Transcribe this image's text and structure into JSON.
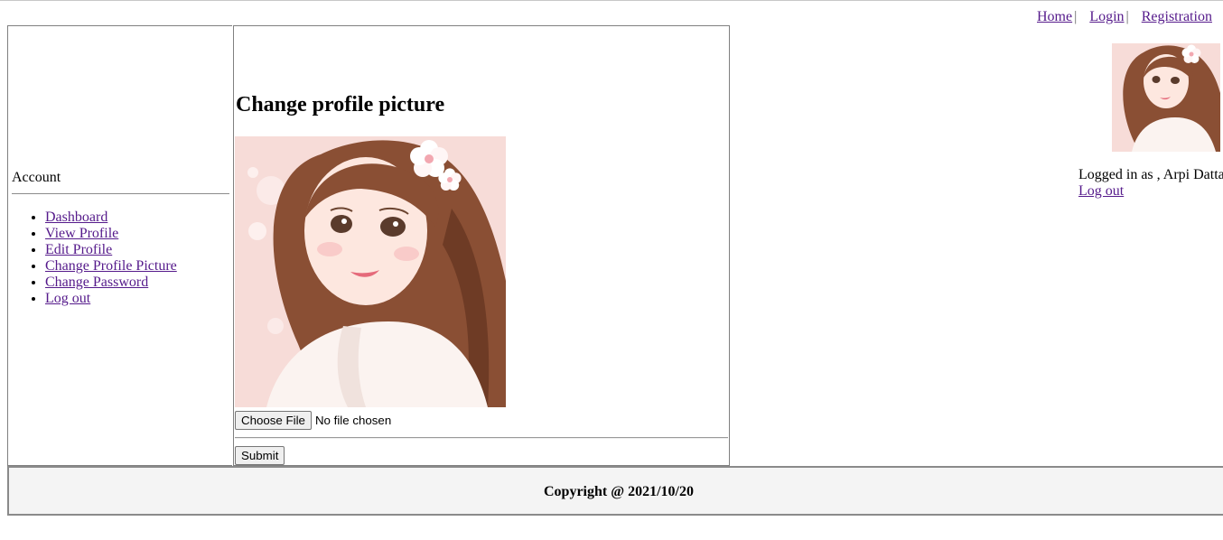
{
  "nav": {
    "links": [
      "Home",
      "Login",
      "Registration"
    ],
    "separator": "|"
  },
  "sidebar": {
    "title": "Account",
    "items": [
      "Dashboard",
      "View Profile",
      "Edit Profile",
      "Change Profile Picture",
      "Change Password",
      "Log out"
    ]
  },
  "main": {
    "title": "Change profile picture",
    "choose_file_label": "Choose File",
    "file_status": "No file chosen",
    "submit_label": "Submit"
  },
  "user_panel": {
    "logged_in_text": "Logged in as , Arpi Datta",
    "logout_label": "Log out"
  },
  "footer": {
    "copyright": "Copyright @ 2021/10/20"
  },
  "colors": {
    "link": "#551a8b",
    "border": "#808080",
    "footer_bg": "#f4f4f4"
  }
}
